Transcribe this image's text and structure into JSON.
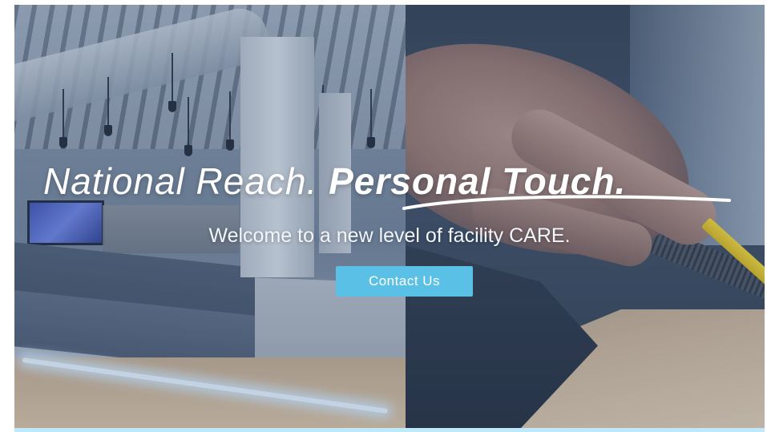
{
  "hero": {
    "headline_part1": "National Reach.",
    "headline_part2": "Personal Touch.",
    "subtitle": "Welcome to a new level of facility CARE.",
    "cta_label": "Contact Us"
  },
  "colors": {
    "cta_background": "#5bc0e6",
    "headline_text": "#ffffff",
    "bottom_accent": "#bfe9fb"
  },
  "images": {
    "left_photo": "office-interior-photo",
    "right_photo": "hand-measuring-pencil-photo"
  }
}
